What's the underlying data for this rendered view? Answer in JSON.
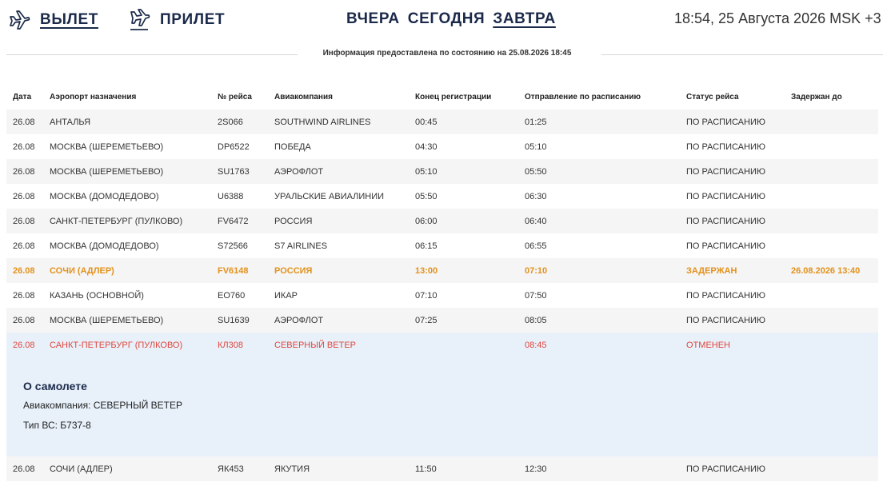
{
  "modes": [
    {
      "label": "ВЫЛЕТ",
      "icon": "plane-departure-icon",
      "active": true
    },
    {
      "label": "ПРИЛЕТ",
      "icon": "plane-arrival-icon",
      "active": false
    }
  ],
  "days": [
    {
      "label": "ВЧЕРА",
      "active": false
    },
    {
      "label": "СЕГОДНЯ",
      "active": false
    },
    {
      "label": "ЗАВТРА",
      "active": true
    }
  ],
  "clock": "18:54, 25 Августа 2026 MSK +3",
  "info_text": "Информация предоставлена по состоянию на 25.08.2026 18:45",
  "columns": [
    "Дата",
    "Аэропорт назначения",
    "№ рейса",
    "Авиакомпания",
    "Конец регистрации",
    "Отправление по расписанию",
    "Статус рейса",
    "Задержан до"
  ],
  "rows": [
    {
      "date": "26.08",
      "destination": "АНТАЛЬЯ",
      "flight": "2S066",
      "airline": "SOUTHWIND AIRLINES",
      "checkin_end": "00:45",
      "departure": "01:25",
      "status": "ПО РАСПИСАНИЮ",
      "delayed_until": "",
      "state": "normal"
    },
    {
      "date": "26.08",
      "destination": "МОСКВА (ШЕРЕМЕТЬЕВО)",
      "flight": "DP6522",
      "airline": "ПОБЕДА",
      "checkin_end": "04:30",
      "departure": "05:10",
      "status": "ПО РАСПИСАНИЮ",
      "delayed_until": "",
      "state": "normal"
    },
    {
      "date": "26.08",
      "destination": "МОСКВА (ШЕРЕМЕТЬЕВО)",
      "flight": "SU1763",
      "airline": "АЭРОФЛОТ",
      "checkin_end": "05:10",
      "departure": "05:50",
      "status": "ПО РАСПИСАНИЮ",
      "delayed_until": "",
      "state": "normal"
    },
    {
      "date": "26.08",
      "destination": "МОСКВА (ДОМОДЕДОВО)",
      "flight": "U6388",
      "airline": "УРАЛЬСКИЕ АВИАЛИНИИ",
      "checkin_end": "05:50",
      "departure": "06:30",
      "status": "ПО РАСПИСАНИЮ",
      "delayed_until": "",
      "state": "normal"
    },
    {
      "date": "26.08",
      "destination": "САНКТ-ПЕТЕРБУРГ (ПУЛКОВО)",
      "flight": "FV6472",
      "airline": "РОССИЯ",
      "checkin_end": "06:00",
      "departure": "06:40",
      "status": "ПО РАСПИСАНИЮ",
      "delayed_until": "",
      "state": "normal"
    },
    {
      "date": "26.08",
      "destination": "МОСКВА (ДОМОДЕДОВО)",
      "flight": "S72566",
      "airline": "S7 AIRLINES",
      "checkin_end": "06:15",
      "departure": "06:55",
      "status": "ПО РАСПИСАНИЮ",
      "delayed_until": "",
      "state": "normal"
    },
    {
      "date": "26.08",
      "destination": "СОЧИ (АДЛЕР)",
      "flight": "FV6148",
      "airline": "РОССИЯ",
      "checkin_end": "13:00",
      "departure": "07:10",
      "status": "ЗАДЕРЖАН",
      "delayed_until": "26.08.2026 13:40",
      "state": "delayed"
    },
    {
      "date": "26.08",
      "destination": "КАЗАНЬ (ОСНОВНОЙ)",
      "flight": "EO760",
      "airline": "ИКАР",
      "checkin_end": "07:10",
      "departure": "07:50",
      "status": "ПО РАСПИСАНИЮ",
      "delayed_until": "",
      "state": "normal"
    },
    {
      "date": "26.08",
      "destination": "МОСКВА (ШЕРЕМЕТЬЕВО)",
      "flight": "SU1639",
      "airline": "АЭРОФЛОТ",
      "checkin_end": "07:25",
      "departure": "08:05",
      "status": "ПО РАСПИСАНИЮ",
      "delayed_until": "",
      "state": "normal"
    },
    {
      "date": "26.08",
      "destination": "САНКТ-ПЕТЕРБУРГ (ПУЛКОВО)",
      "flight": "КЛ308",
      "airline": "СЕВЕРНЫЙ ВЕТЕР",
      "checkin_end": "",
      "departure": "08:45",
      "status": "ОТМЕНЕН",
      "delayed_until": "",
      "state": "cancelled"
    },
    {
      "date": "26.08",
      "destination": "СОЧИ (АДЛЕР)",
      "flight": "ЯК453",
      "airline": "ЯКУТИЯ",
      "checkin_end": "11:50",
      "departure": "12:30",
      "status": "ПО РАСПИСАНИЮ",
      "delayed_until": "",
      "state": "normal"
    }
  ],
  "details": {
    "heading": "О самолете",
    "airline_line": "Авиакомпания: СЕВЕРНЫЙ ВЕТЕР",
    "aircraft_line": "Тип ВС: Б737-8"
  },
  "colors": {
    "navy": "#1b2a4a",
    "delayed": "#e3911b",
    "cancelled": "#e0463d",
    "highlight_bg": "#e8f1fa"
  }
}
